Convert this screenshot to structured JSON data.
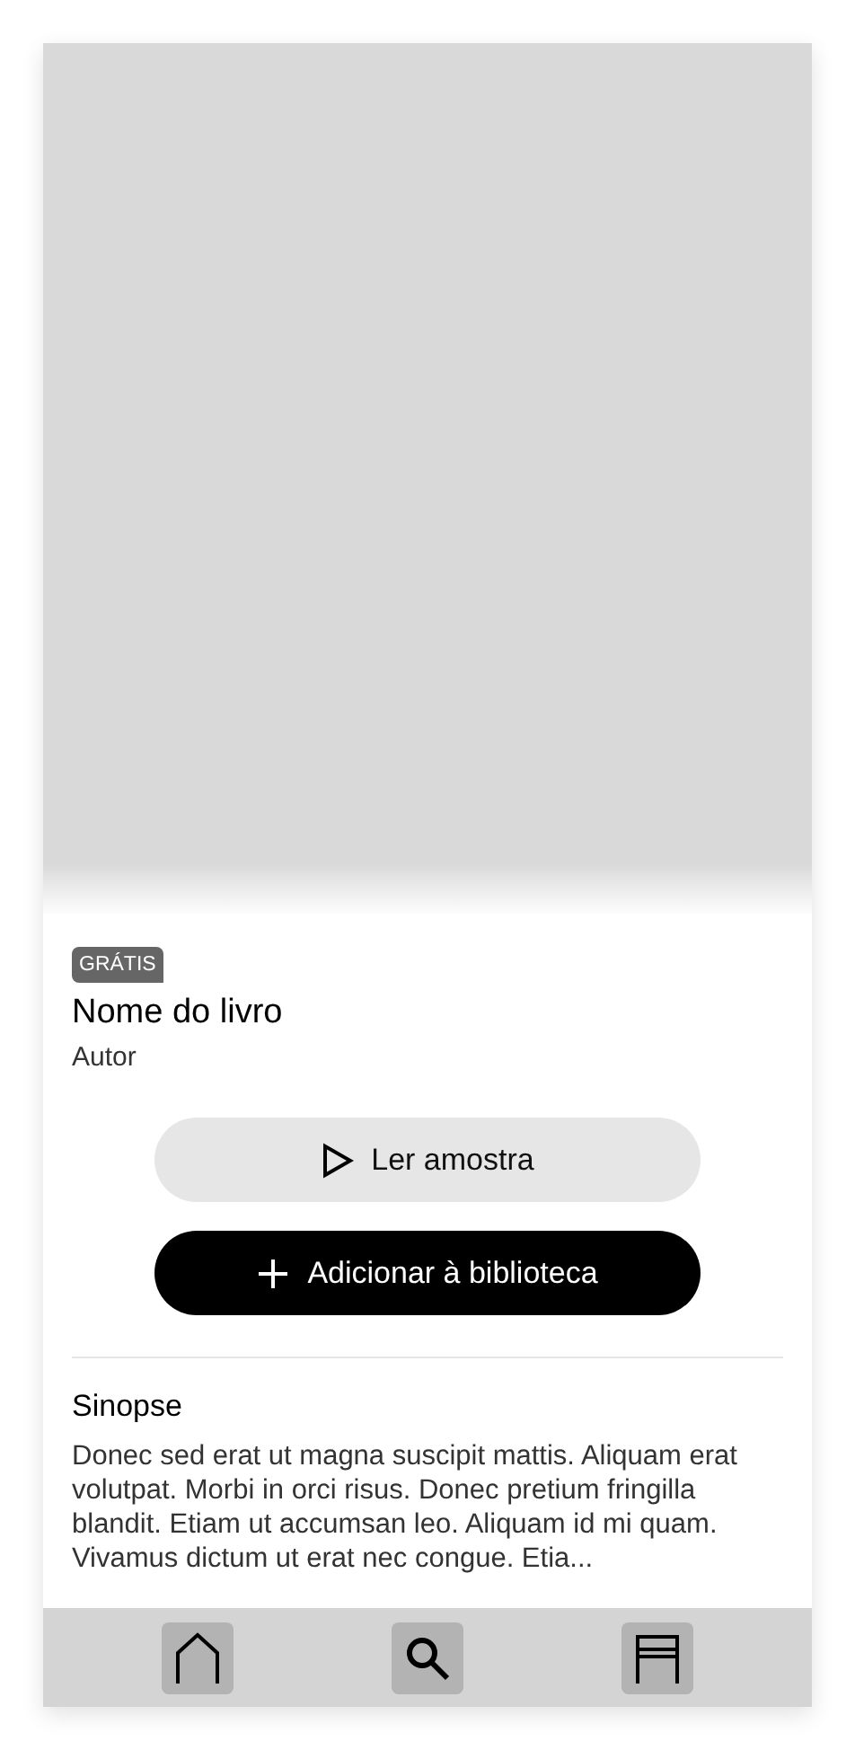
{
  "book": {
    "badge": "GRÁTIS",
    "title": "Nome do livro",
    "author": "Autor"
  },
  "actions": [
    {
      "kind": "secondary",
      "label": "Ler amostra"
    },
    {
      "kind": "primary",
      "label": "Adicionar à biblioteca"
    }
  ],
  "synopsis": {
    "heading": "Sinopse",
    "text": "Donec sed erat ut magna suscipit mattis. Aliquam erat volutpat. Morbi in orci risus. Donec pretium fringilla blandit. Etiam ut accumsan leo. Aliquam id mi quam. Vivamus dictum ut erat nec congue. Etia..."
  }
}
